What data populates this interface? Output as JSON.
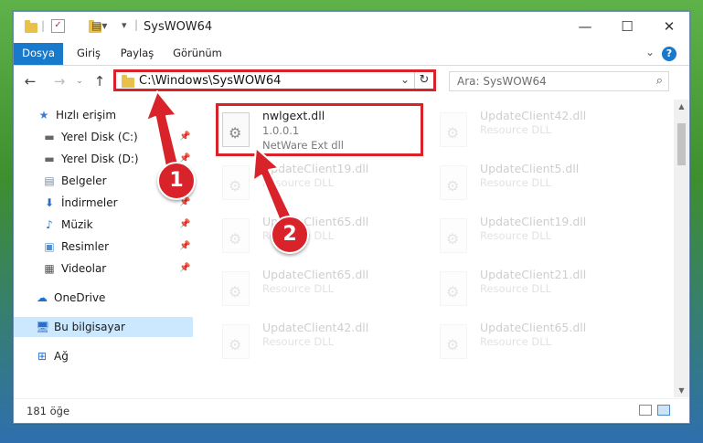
{
  "window": {
    "title": "SysWOW64"
  },
  "controls": {
    "minimize": "—",
    "maximize": "☐",
    "close": "✕"
  },
  "tabs": [
    {
      "label": "Dosya",
      "active": true
    },
    {
      "label": "Giriş"
    },
    {
      "label": "Paylaş"
    },
    {
      "label": "Görünüm"
    }
  ],
  "nav": {
    "address": "C:\\Windows\\SysWOW64",
    "search_placeholder": "Ara: SysWOW64"
  },
  "sidebar": {
    "items": [
      {
        "label": "Hızlı erişim",
        "icon": "star-icon"
      },
      {
        "label": "Yerel Disk (C:)",
        "icon": "drive-icon",
        "pinned": true
      },
      {
        "label": "Yerel Disk (D:)",
        "icon": "drive-icon",
        "pinned": true
      },
      {
        "label": "Belgeler",
        "icon": "documents-icon",
        "pinned": true
      },
      {
        "label": "İndirmeler",
        "icon": "download-icon",
        "pinned": true
      },
      {
        "label": "Müzik",
        "icon": "music-icon",
        "pinned": true
      },
      {
        "label": "Resimler",
        "icon": "pictures-icon",
        "pinned": true
      },
      {
        "label": "Videolar",
        "icon": "videos-icon",
        "pinned": true
      },
      {
        "label": "OneDrive",
        "icon": "cloud-icon"
      },
      {
        "label": "Bu bilgisayar",
        "icon": "computer-icon",
        "selected": true
      },
      {
        "label": "Ağ",
        "icon": "network-icon"
      }
    ]
  },
  "files": [
    {
      "name": "nwlgext.dll",
      "version": "1.0.0.1",
      "desc": "NetWare Ext dll",
      "highlighted": true
    },
    {
      "name": "UpdateClient42.dll",
      "desc": "Resource DLL"
    },
    {
      "name": "UpdateClient19.dll",
      "desc": "Resource DLL"
    },
    {
      "name": "UpdateClient5.dll",
      "desc": "Resource DLL"
    },
    {
      "name": "UpdateClient65.dll",
      "desc": "Resource DLL"
    },
    {
      "name": "UpdateClient19.dll",
      "desc": "Resource DLL"
    },
    {
      "name": "UpdateClient65.dll",
      "desc": "Resource DLL"
    },
    {
      "name": "UpdateClient21.dll",
      "desc": "Resource DLL"
    },
    {
      "name": "UpdateClient42.dll",
      "desc": "Resource DLL"
    },
    {
      "name": "UpdateClient65.dll",
      "desc": "Resource DLL"
    }
  ],
  "status": {
    "count": "181 öğe"
  },
  "annotations": {
    "badge1": "1",
    "badge2": "2"
  },
  "colors": {
    "accent": "#1979ca",
    "annotation": "#d8232a",
    "selection": "#cce8ff"
  }
}
